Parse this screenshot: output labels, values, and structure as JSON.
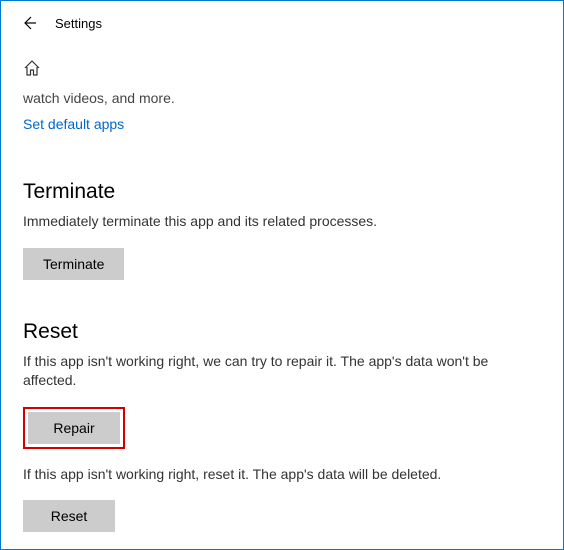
{
  "header": {
    "title": "Settings"
  },
  "truncated_line": "watch videos, and more.",
  "link_text": "Set default apps",
  "terminate": {
    "heading": "Terminate",
    "text": "Immediately terminate this app and its related processes.",
    "button": "Terminate"
  },
  "reset": {
    "heading": "Reset",
    "repair_text": "If this app isn't working right, we can try to repair it. The app's data won't be affected.",
    "repair_button": "Repair",
    "reset_text": "If this app isn't working right, reset it. The app's data will be deleted.",
    "reset_button": "Reset"
  }
}
